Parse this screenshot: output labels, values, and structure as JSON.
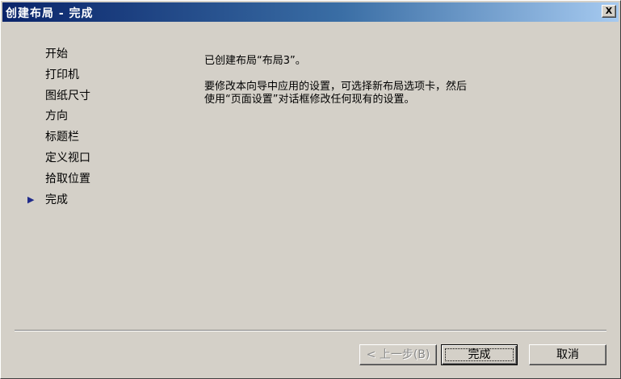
{
  "window": {
    "title": "创建布局 - 完成",
    "close_glyph": "X"
  },
  "steps": [
    {
      "label": "开始",
      "current": false
    },
    {
      "label": "打印机",
      "current": false
    },
    {
      "label": "图纸尺寸",
      "current": false
    },
    {
      "label": "方向",
      "current": false
    },
    {
      "label": "标题栏",
      "current": false
    },
    {
      "label": "定义视口",
      "current": false
    },
    {
      "label": "拾取位置",
      "current": false
    },
    {
      "label": "完成",
      "current": true
    }
  ],
  "current_step_marker": "▶",
  "content": {
    "created_message": "已创建布局“布局3”。",
    "instructions": "要修改本向导中应用的设置，可选择新布局选项卡，然后使用“页面设置”对话框修改任何现有的设置。"
  },
  "buttons": {
    "back": "< 上一步(B)",
    "finish": "完成",
    "cancel": "取消"
  },
  "colors": {
    "title_gradient_start": "#0a246a",
    "title_gradient_end": "#a6caf0",
    "face": "#d4d0c8",
    "marker": "#1f2a8a"
  }
}
